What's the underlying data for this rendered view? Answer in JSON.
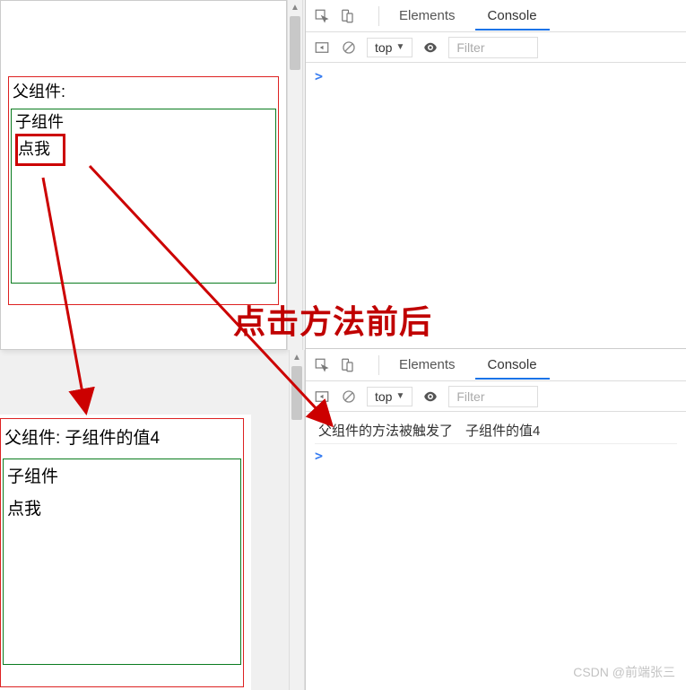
{
  "annotation": "点击方法前后",
  "watermark": "CSDN @前端张三",
  "panel_before": {
    "parent_label": "父组件:",
    "child_label": "子组件",
    "button_label": "点我"
  },
  "panel_after": {
    "parent_label": "父组件: 子组件的值4",
    "child_label": "子组件",
    "button_label": "点我"
  },
  "devtools_top": {
    "tabs": {
      "elements": "Elements",
      "console": "Console"
    },
    "toolbar": {
      "context": "top",
      "filter_placeholder": "Filter"
    },
    "prompt": ">"
  },
  "devtools_bottom": {
    "tabs": {
      "elements": "Elements",
      "console": "Console"
    },
    "toolbar": {
      "context": "top",
      "filter_placeholder": "Filter"
    },
    "log": {
      "msg": "父组件的方法被触发了",
      "val": "子组件的值4"
    },
    "prompt": ">"
  }
}
